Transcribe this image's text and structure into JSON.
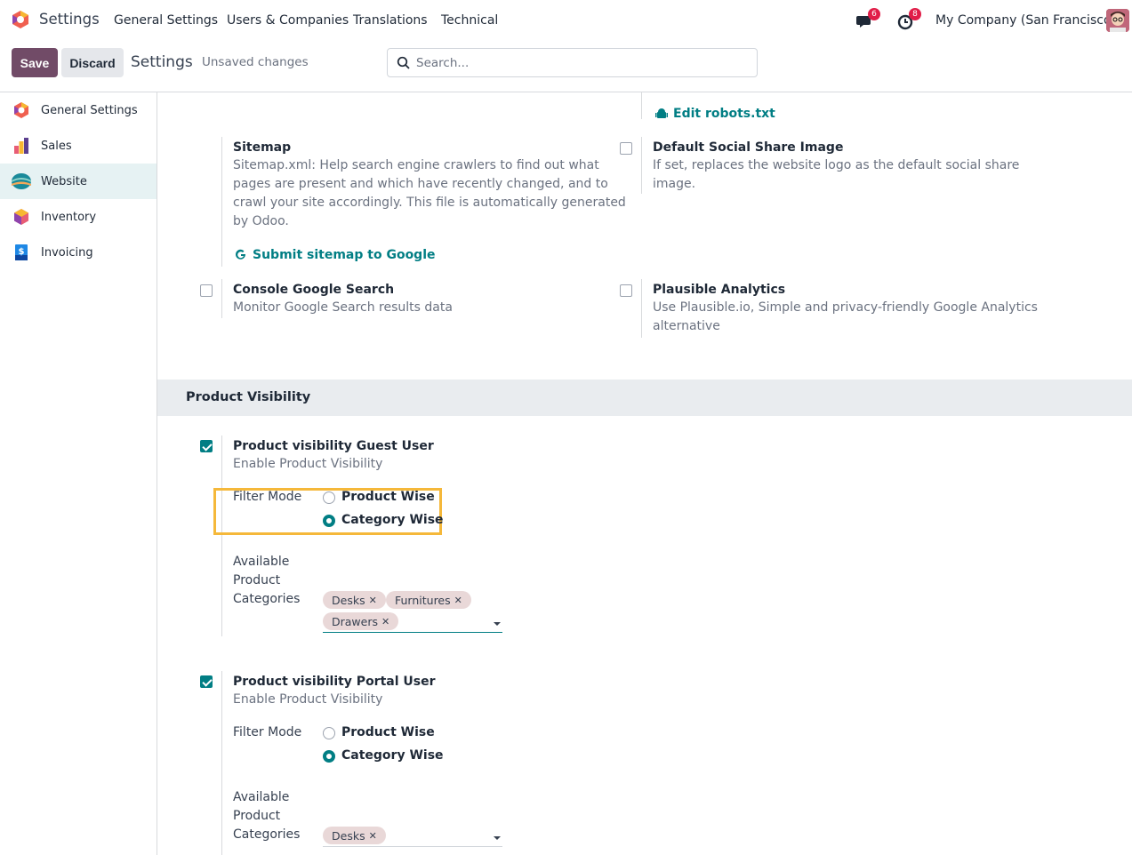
{
  "navbar": {
    "app_name": "Settings",
    "menus": [
      "General Settings",
      "Users & Companies",
      "Translations",
      "Technical"
    ],
    "messages_badge": "6",
    "activities_badge": "8",
    "company": "My Company (San Francisco)"
  },
  "control_panel": {
    "save_label": "Save",
    "discard_label": "Discard",
    "title": "Settings",
    "status": "Unsaved changes",
    "search_placeholder": "Search..."
  },
  "sidebar": {
    "items": [
      {
        "label": "General Settings",
        "icon": "settings-app-icon"
      },
      {
        "label": "Sales",
        "icon": "sales-app-icon"
      },
      {
        "label": "Website",
        "icon": "website-app-icon",
        "active": true
      },
      {
        "label": "Inventory",
        "icon": "inventory-app-icon"
      },
      {
        "label": "Invoicing",
        "icon": "invoicing-app-icon"
      }
    ]
  },
  "settings": {
    "robots_link": "Edit robots.txt",
    "sitemap": {
      "title": "Sitemap",
      "desc_lines": [
        "Sitemap.xml: Help search engine crawlers to find out what",
        "pages are present and which have recently changed, and to",
        "crawl your site accordingly. This file is automatically generated",
        "by Odoo."
      ],
      "link": "Submit sitemap to Google"
    },
    "social_image": {
      "title": "Default Social Share Image",
      "desc_lines": [
        "If set, replaces the website logo as the default social share",
        "image."
      ],
      "checked": false
    },
    "console_search": {
      "title": "Console Google Search",
      "desc": "Monitor Google Search results data",
      "checked": false
    },
    "plausible": {
      "title": "Plausible Analytics",
      "desc_lines": [
        "Use Plausible.io, Simple and privacy-friendly Google Analytics",
        "alternative"
      ],
      "checked": false
    }
  },
  "product_visibility": {
    "section_title": "Product Visibility",
    "guest": {
      "title": "Product visibility Guest User",
      "desc": "Enable Product Visibility",
      "checked": true,
      "filter_label": "Filter Mode",
      "options": [
        "Product Wise",
        "Category Wise"
      ],
      "selected": "Category Wise",
      "categories_label_lines": [
        "Available",
        "Product",
        "Categories"
      ],
      "tags": [
        "Desks",
        "Furnitures",
        "Drawers"
      ]
    },
    "portal": {
      "title": "Product visibility Portal User",
      "desc": "Enable Product Visibility",
      "checked": true,
      "filter_label": "Filter Mode",
      "options": [
        "Product Wise",
        "Category Wise"
      ],
      "selected": "Category Wise",
      "categories_label_lines": [
        "Available",
        "Product",
        "Categories"
      ],
      "tags": [
        "Desks"
      ]
    }
  },
  "colors": {
    "primary": "#714b67",
    "accent": "#017e84",
    "highlight": "#f5b83a",
    "badge": "#e11d48"
  }
}
